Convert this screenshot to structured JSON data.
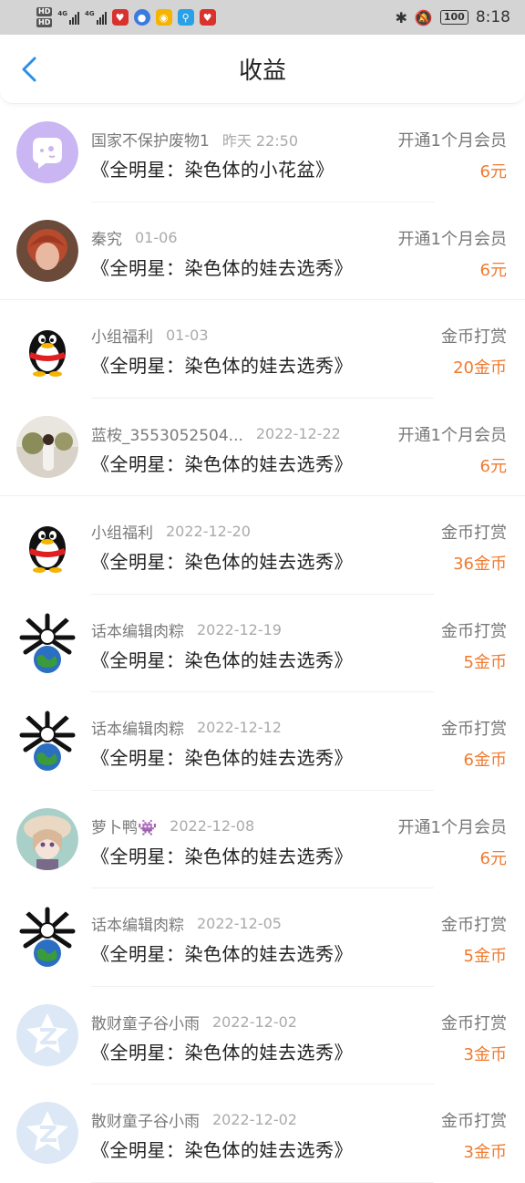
{
  "status_bar": {
    "time": "8:18",
    "battery": "100",
    "network": [
      "4G",
      "4G"
    ]
  },
  "header": {
    "title": "收益",
    "back_icon": "chevron-left-icon"
  },
  "rows": [
    {
      "name": "国家不保护废物1",
      "date": "昨天 22:50",
      "work": "《全明星：染色体的小花盆》",
      "type": "开通1个月会员",
      "amount": "6元",
      "avatar": "chat-bubble-avatar"
    },
    {
      "name": "秦究",
      "date": "01-06",
      "work": "《全明星：染色体的娃去选秀》",
      "type": "开通1个月会员",
      "amount": "6元",
      "avatar": "photo-avatar-redhair"
    },
    {
      "name": "小组福利",
      "date": "01-03",
      "work": "《全明星：染色体的娃去选秀》",
      "type": "金币打赏",
      "amount": "20金币",
      "avatar": "penguin-avatar"
    },
    {
      "name": "蓝桉_3553052504...",
      "date": "2022-12-22",
      "work": "《全明星：染色体的娃去选秀》",
      "type": "开通1个月会员",
      "amount": "6元",
      "avatar": "photo-avatar-outdoor"
    },
    {
      "name": "小组福利",
      "date": "2022-12-20",
      "work": "《全明星：染色体的娃去选秀》",
      "type": "金币打赏",
      "amount": "36金币",
      "avatar": "penguin-avatar"
    },
    {
      "name": "话本编辑肉粽",
      "date": "2022-12-19",
      "work": "《全明星：染色体的娃去选秀》",
      "type": "金币打赏",
      "amount": "5金币",
      "avatar": "globe-avatar"
    },
    {
      "name": "话本编辑肉粽",
      "date": "2022-12-12",
      "work": "《全明星：染色体的娃去选秀》",
      "type": "金币打赏",
      "amount": "6金币",
      "avatar": "globe-avatar"
    },
    {
      "name": "萝卜鸭👾",
      "date": "2022-12-08",
      "work": "《全明星：染色体的娃去选秀》",
      "type": "开通1个月会员",
      "amount": "6元",
      "avatar": "anime-avatar"
    },
    {
      "name": "话本编辑肉粽",
      "date": "2022-12-05",
      "work": "《全明星：染色体的娃去选秀》",
      "type": "金币打赏",
      "amount": "5金币",
      "avatar": "globe-avatar"
    },
    {
      "name": "散财童子谷小雨",
      "date": "2022-12-02",
      "work": "《全明星：染色体的娃去选秀》",
      "type": "金币打赏",
      "amount": "3金币",
      "avatar": "default-z-avatar"
    },
    {
      "name": "散财童子谷小雨",
      "date": "2022-12-02",
      "work": "《全明星：染色体的娃去选秀》",
      "type": "金币打赏",
      "amount": "3金币",
      "avatar": "default-z-avatar"
    }
  ],
  "colors": {
    "accent": "#2c8ee8",
    "amount": "#f07a2e",
    "status_bar_bg": "#d4d4d4"
  }
}
